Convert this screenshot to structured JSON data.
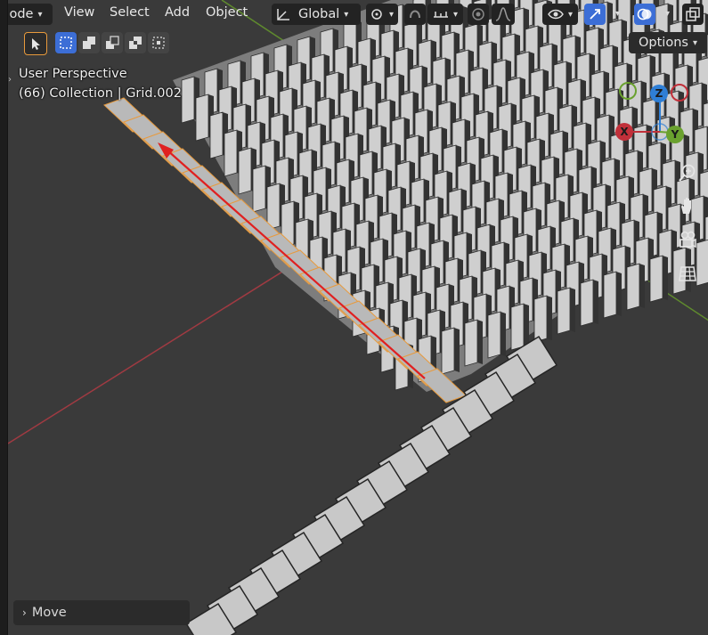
{
  "header": {
    "mode_label": "ode",
    "menus": [
      "View",
      "Select",
      "Add",
      "Object"
    ],
    "transform_orientation": "Global",
    "options_label": "Options"
  },
  "overlay": {
    "perspective": "User Perspective",
    "collection": "(66) Collection | Grid.002"
  },
  "gizmo": {
    "x": "X",
    "y": "Y",
    "z": "Z"
  },
  "last_operator": {
    "label": "Move"
  },
  "colors": {
    "viewport_bg": "#3a3a3a",
    "header_bg": "#232323",
    "active_blue": "#3c6ed6",
    "selection_orange": "#e89a3c",
    "x_axis": "#c1303a",
    "y_axis": "#6aa12f",
    "z_axis": "#2f7fd6"
  },
  "icons": [
    "mode-dropdown-icon",
    "orientation-icon",
    "pivot-icon",
    "snap-icon",
    "snap-increment-icon",
    "proportional-icon",
    "falloff-icon",
    "visibility-icon",
    "gizmo-icon",
    "overlay-icon",
    "xray-icon",
    "select-box-icon",
    "mode-new-icon",
    "mode-extend-icon",
    "mode-subtract-icon",
    "mode-invert-icon",
    "mode-intersect-icon",
    "zoom-icon",
    "pan-icon",
    "camera-icon",
    "grid-view-icon"
  ]
}
